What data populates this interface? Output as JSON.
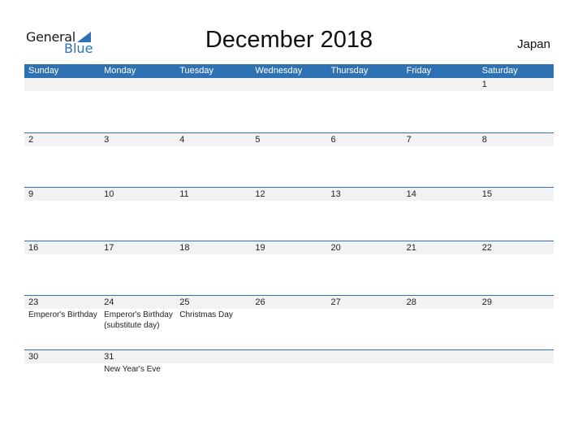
{
  "logo": {
    "line1": "General",
    "line2": "Blue"
  },
  "title": "December 2018",
  "country": "Japan",
  "colors": {
    "accent": "#2f72b3",
    "strip": "#f2f2f2"
  },
  "weekdays": [
    "Sunday",
    "Monday",
    "Tuesday",
    "Wednesday",
    "Thursday",
    "Friday",
    "Saturday"
  ],
  "weeks": [
    [
      {
        "d": ""
      },
      {
        "d": ""
      },
      {
        "d": ""
      },
      {
        "d": ""
      },
      {
        "d": ""
      },
      {
        "d": ""
      },
      {
        "d": "1"
      }
    ],
    [
      {
        "d": "2"
      },
      {
        "d": "3"
      },
      {
        "d": "4"
      },
      {
        "d": "5"
      },
      {
        "d": "6"
      },
      {
        "d": "7"
      },
      {
        "d": "8"
      }
    ],
    [
      {
        "d": "9"
      },
      {
        "d": "10"
      },
      {
        "d": "11"
      },
      {
        "d": "12"
      },
      {
        "d": "13"
      },
      {
        "d": "14"
      },
      {
        "d": "15"
      }
    ],
    [
      {
        "d": "16"
      },
      {
        "d": "17"
      },
      {
        "d": "18"
      },
      {
        "d": "19"
      },
      {
        "d": "20"
      },
      {
        "d": "21"
      },
      {
        "d": "22"
      }
    ],
    [
      {
        "d": "23",
        "e": [
          "Emperor's Birthday"
        ]
      },
      {
        "d": "24",
        "e": [
          "Emperor's Birthday",
          "(substitute day)"
        ]
      },
      {
        "d": "25",
        "e": [
          "Christmas Day"
        ]
      },
      {
        "d": "26"
      },
      {
        "d": "27"
      },
      {
        "d": "28"
      },
      {
        "d": "29"
      }
    ],
    [
      {
        "d": "30"
      },
      {
        "d": "31",
        "e": [
          "New Year's Eve"
        ]
      },
      {
        "d": ""
      },
      {
        "d": ""
      },
      {
        "d": ""
      },
      {
        "d": ""
      },
      {
        "d": ""
      }
    ]
  ]
}
